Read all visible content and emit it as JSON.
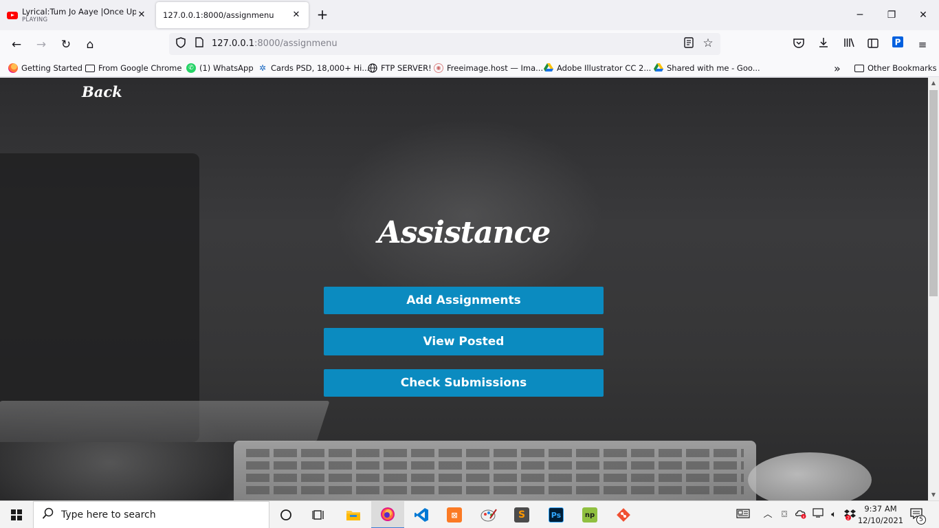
{
  "browser": {
    "tabs": [
      {
        "title": "Lyrical:Tum Jo Aaye |Once Upon",
        "subtitle": "PLAYING",
        "close": "✕"
      },
      {
        "title": "127.0.0.1:8000/assignmenu",
        "close": "✕"
      }
    ],
    "new_tab": "+",
    "window_controls": {
      "minimize": "─",
      "maximize": "❐",
      "close": "✕"
    },
    "nav": {
      "back": "←",
      "forward": "→",
      "reload": "↻",
      "home": "⌂"
    },
    "url": {
      "host": "127.0.0.1",
      "rest": ":8000/assignmenu"
    },
    "toolbar": {
      "pocket": "◫",
      "downloads": "⤓",
      "library": "⫴",
      "sidebar": "▤",
      "extension": "P",
      "menu": "≡"
    },
    "bookmarks": [
      "Getting Started",
      "From Google Chrome",
      "(1) WhatsApp",
      "Cards PSD, 18,000+ Hi...",
      "FTP SERVER!",
      "Freeimage.host — Ima...",
      "Adobe Illustrator CC 2...",
      "Shared with me - Goo..."
    ],
    "bookmarks_overflow": "»",
    "other_bookmarks": "Other Bookmarks"
  },
  "page": {
    "back_label": "Back",
    "title": "Assistance",
    "buttons": [
      "Add Assignments",
      "View Posted",
      "Check Submissions"
    ],
    "button_color": "#0b8bc0"
  },
  "taskbar": {
    "search_placeholder": "Type here to search",
    "apps": [
      "cortana-icon",
      "task-view-icon",
      "file-explorer-icon",
      "firefox-icon",
      "vscode-icon",
      "xampp-icon",
      "paint-icon",
      "sublime-text-icon",
      "photoshop-icon",
      "notepad-plus-icon",
      "git-icon"
    ],
    "time": "9:37 AM",
    "date": "12/10/2021",
    "notification_count": "5",
    "dropbox_badge": "2"
  }
}
